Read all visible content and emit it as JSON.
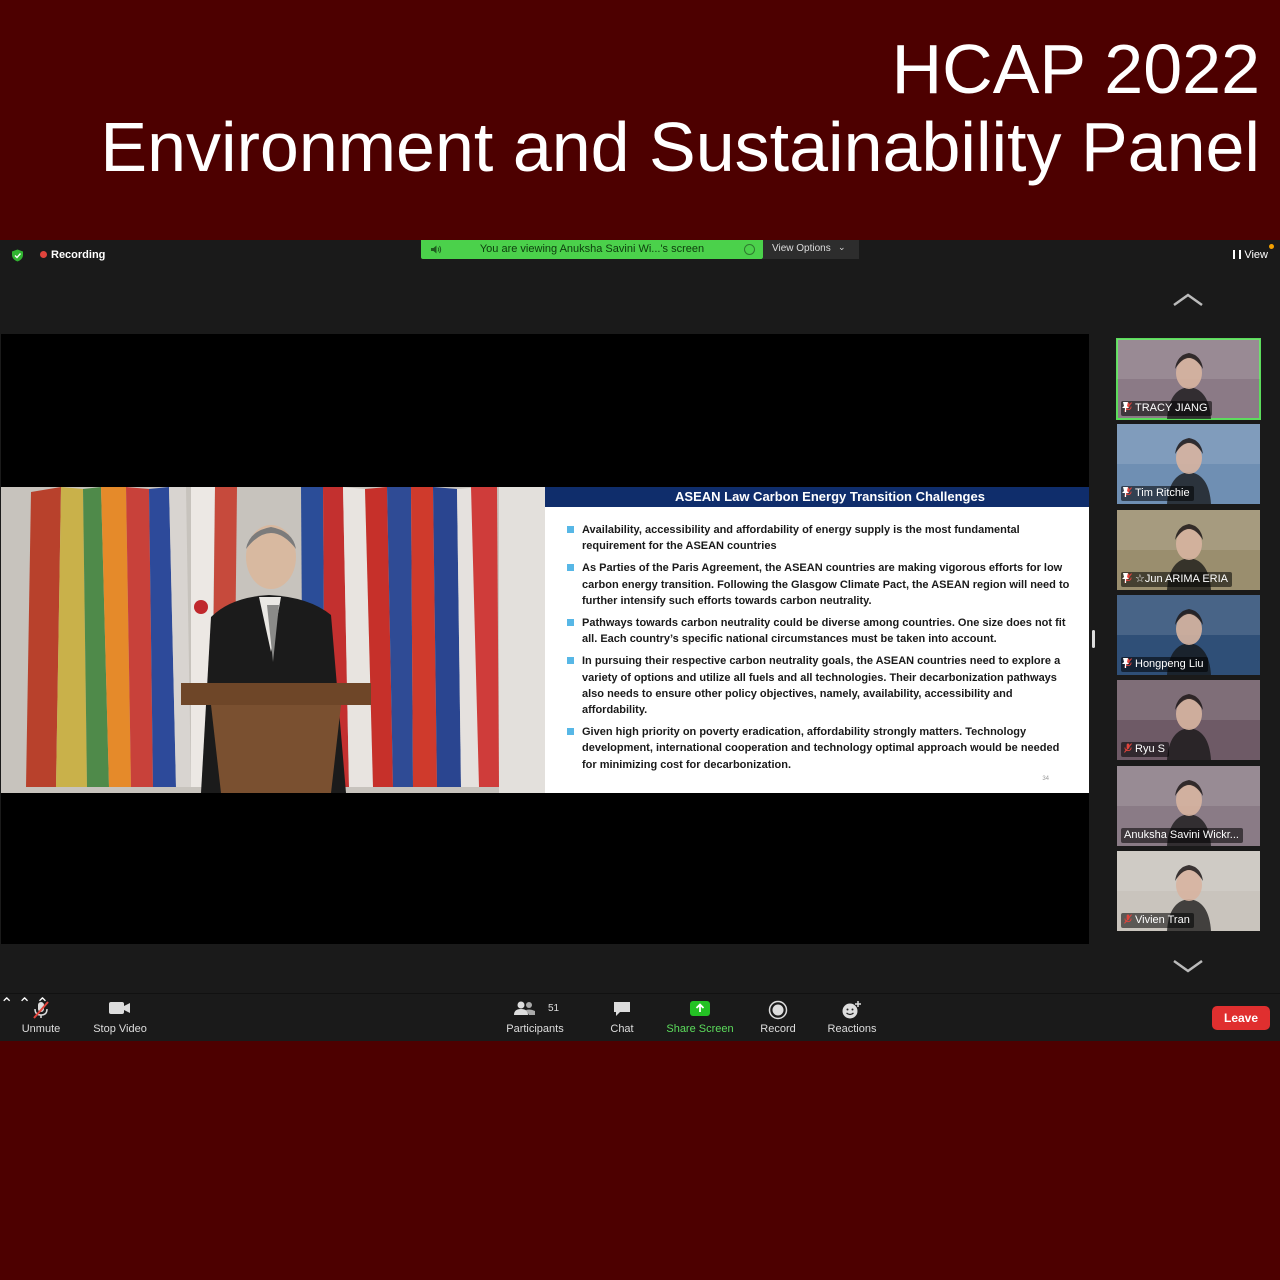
{
  "banner": {
    "line1": "HCAP 2022",
    "line2": "Environment and Sustainability Panel"
  },
  "meeting": {
    "recording_label": "Recording",
    "viewing_text": "You are viewing Anuksha Savini Wi...'s screen",
    "view_options_label": "View Options",
    "view_label": "View"
  },
  "slide": {
    "title": "ASEAN Law Carbon Energy Transition Challenges",
    "bullets": [
      "Availability, accessibility and affordability of energy supply is the most fundamental requirement for the ASEAN countries",
      "As Parties of the Paris Agreement, the ASEAN countries are making vigorous efforts for low carbon energy transition. Following the Glasgow Climate Pact, the ASEAN region will need to further intensify such efforts towards carbon neutrality.",
      "Pathways towards carbon neutrality could be diverse among countries. One size does not fit all. Each country’s specific national circumstances must be taken into account.",
      "In pursuing their respective carbon neutrality goals, the ASEAN countries need to explore a variety of options and utilize all fuels and all technologies. Their decarbonization pathways also needs to ensure other policy objectives, namely, availability, accessibility and affordability.",
      "Given high priority on poverty eradication, affordability strongly matters. Technology development, international cooperation and technology optimal approach would be needed for minimizing cost for decarbonization."
    ],
    "page_number": "34"
  },
  "gallery": [
    {
      "name": "TRACY JIANG",
      "pinned": true,
      "muted": true,
      "active": true,
      "bg": "#8b7a86"
    },
    {
      "name": "Tim Ritchie",
      "pinned": true,
      "muted": true,
      "active": false,
      "bg": "#6f8fb3"
    },
    {
      "name": "☆Jun ARIMA ERIA",
      "pinned": true,
      "muted": true,
      "active": false,
      "bg": "#9a8e6e"
    },
    {
      "name": "Hongpeng Liu",
      "pinned": true,
      "muted": true,
      "active": false,
      "bg": "#2f4f77"
    },
    {
      "name": "Ryu S",
      "pinned": false,
      "muted": true,
      "active": false,
      "bg": "#6e5a66"
    },
    {
      "name": "Anuksha Savini Wickr...",
      "pinned": false,
      "muted": false,
      "active": false,
      "bg": "#8a7b86"
    },
    {
      "name": "Vivien Tran",
      "pinned": false,
      "muted": true,
      "active": false,
      "bg": "#c9c4bd"
    }
  ],
  "controls": {
    "unmute": "Unmute",
    "stop_video": "Stop Video",
    "participants": "Participants",
    "participant_count": "51",
    "chat": "Chat",
    "share_screen": "Share Screen",
    "record": "Record",
    "reactions": "Reactions",
    "leave": "Leave"
  },
  "colors": {
    "background": "#4d0000",
    "banner_bar": "#4bd14b",
    "leave": "#e02f2f",
    "slide_header": "#0f2d6b",
    "bullet": "#57b7e6"
  }
}
